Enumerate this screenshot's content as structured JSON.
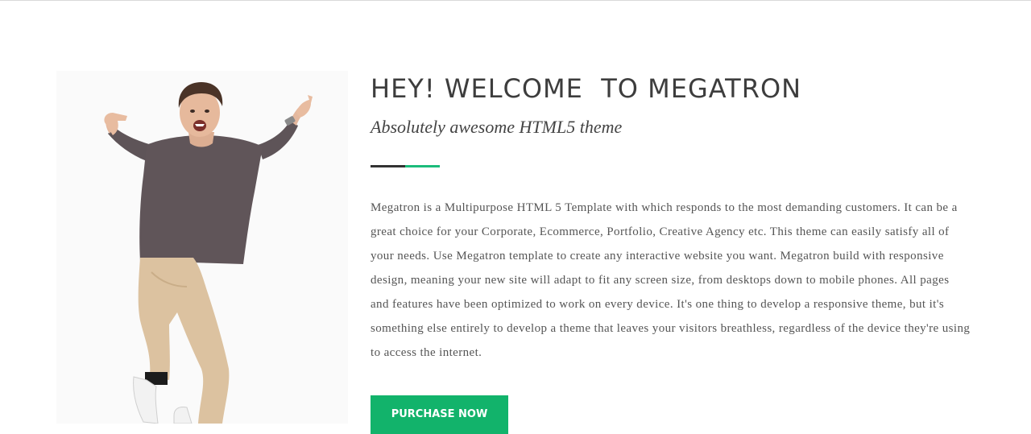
{
  "welcome": {
    "heading": "HEY! WELCOME  TO MEGATRON",
    "subheading": "Absolutely awesome HTML5 theme",
    "body": "Megatron is a Multipurpose HTML 5 Template with which responds to the most demanding customers. It can be a great choice for your Corporate, Ecommerce, Portfolio, Creative Agency etc. This theme can easily satisfy all of your needs. Use Megatron template to create any interactive website you want. Megatron build with responsive design, meaning your new site will adapt to fit any screen size, from desktops down to mobile phones. All pages and features have been optimized to work on every device. It's one thing to develop a responsive theme, but it's something else entirely to develop a theme that leaves your visitors breathless, regardless of the device they're using to access the internet.",
    "button_label": "PURCHASE NOW"
  },
  "colors": {
    "accent": "#12b36b",
    "divider_dark": "#333333",
    "divider_green": "#1bbc7b",
    "heading": "#3d3d3d",
    "text": "#555555"
  },
  "image": {
    "subject": "jumping-man-photo"
  }
}
